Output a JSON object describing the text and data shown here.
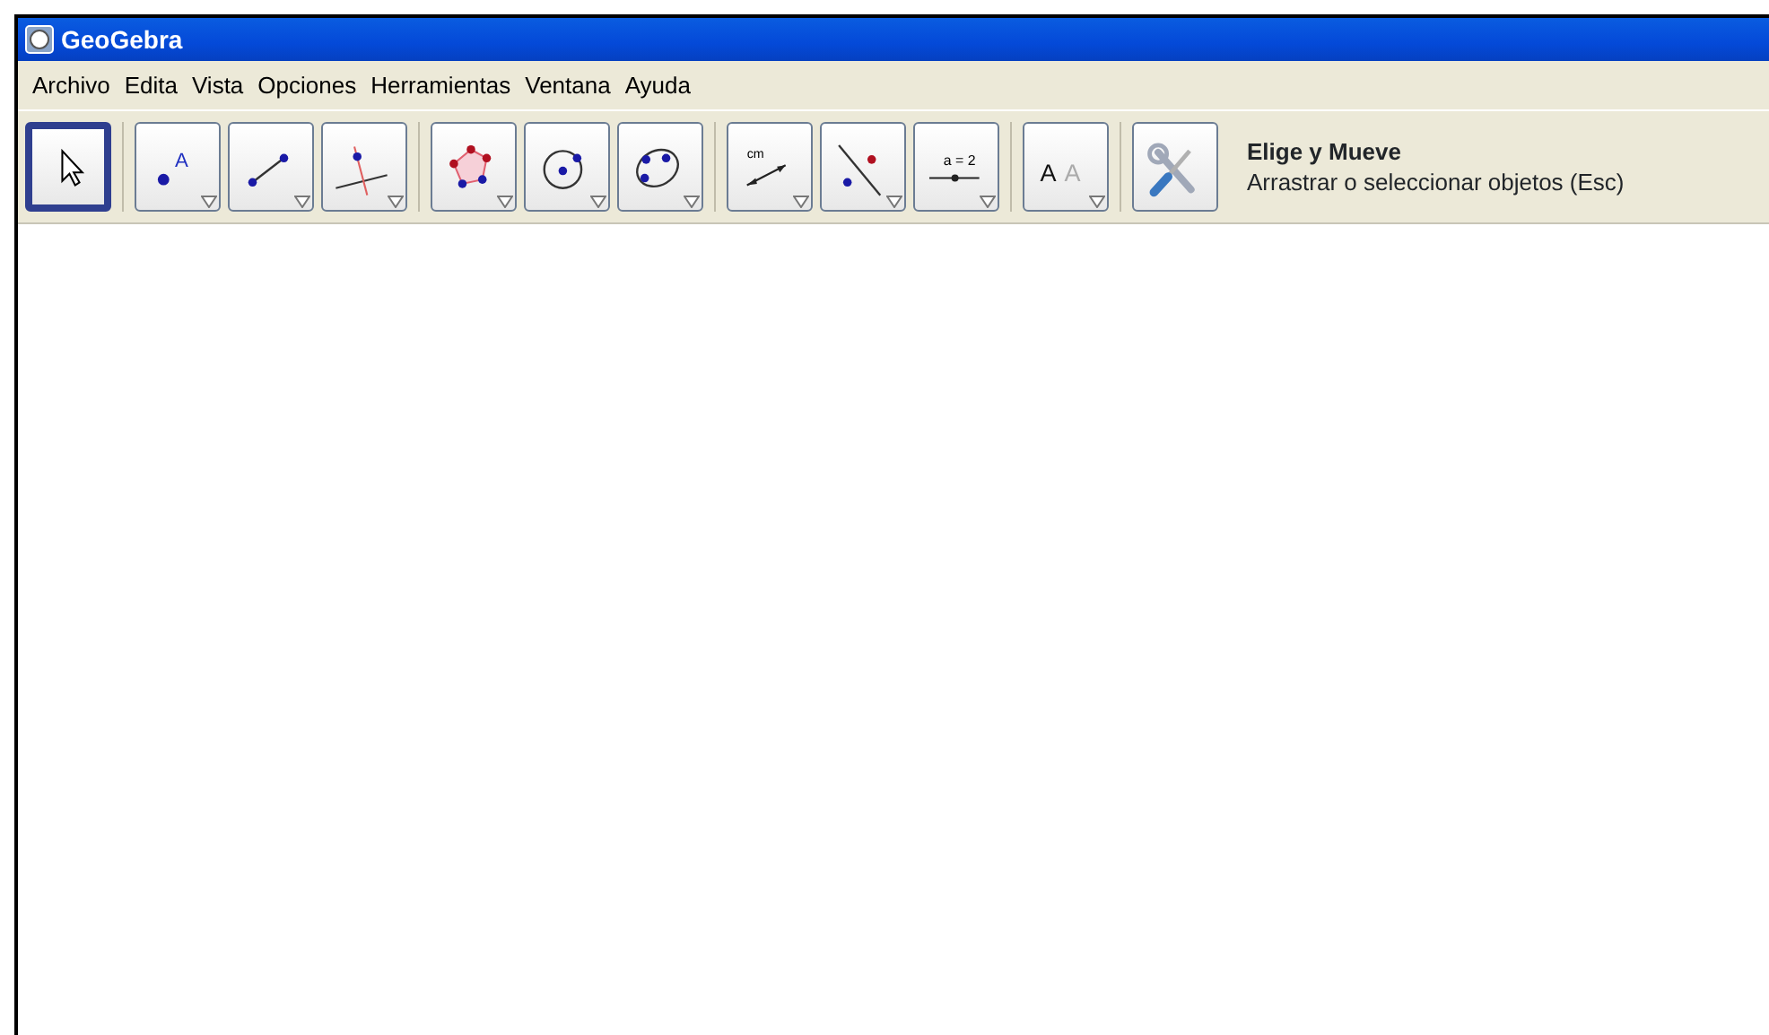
{
  "window": {
    "title": "GeoGebra"
  },
  "menu": [
    "Archivo",
    "Edita",
    "Vista",
    "Opciones",
    "Herramientas",
    "Ventana",
    "Ayuda"
  ],
  "toolbar": {
    "groups": [
      [
        {
          "kind": "move",
          "selected": true
        }
      ],
      [
        {
          "kind": "point",
          "selected": false,
          "labels": [
            "A"
          ]
        },
        {
          "kind": "segment",
          "selected": false
        },
        {
          "kind": "perpendicular",
          "selected": false
        }
      ],
      [
        {
          "kind": "polygon",
          "selected": false
        },
        {
          "kind": "circle",
          "selected": false
        },
        {
          "kind": "conic",
          "selected": false
        }
      ],
      [
        {
          "kind": "distance",
          "selected": false,
          "labels": [
            "cm"
          ]
        },
        {
          "kind": "reflect",
          "selected": false
        },
        {
          "kind": "slider",
          "selected": false,
          "labels": [
            "a = 2"
          ]
        }
      ],
      [
        {
          "kind": "text",
          "selected": false,
          "labels": [
            "A",
            "A"
          ]
        }
      ],
      [
        {
          "kind": "tools",
          "selected": false
        }
      ]
    ]
  },
  "tool_help": {
    "title": "Elige y Mueve",
    "description": "Arrastrar o seleccionar objetos (Esc)"
  }
}
